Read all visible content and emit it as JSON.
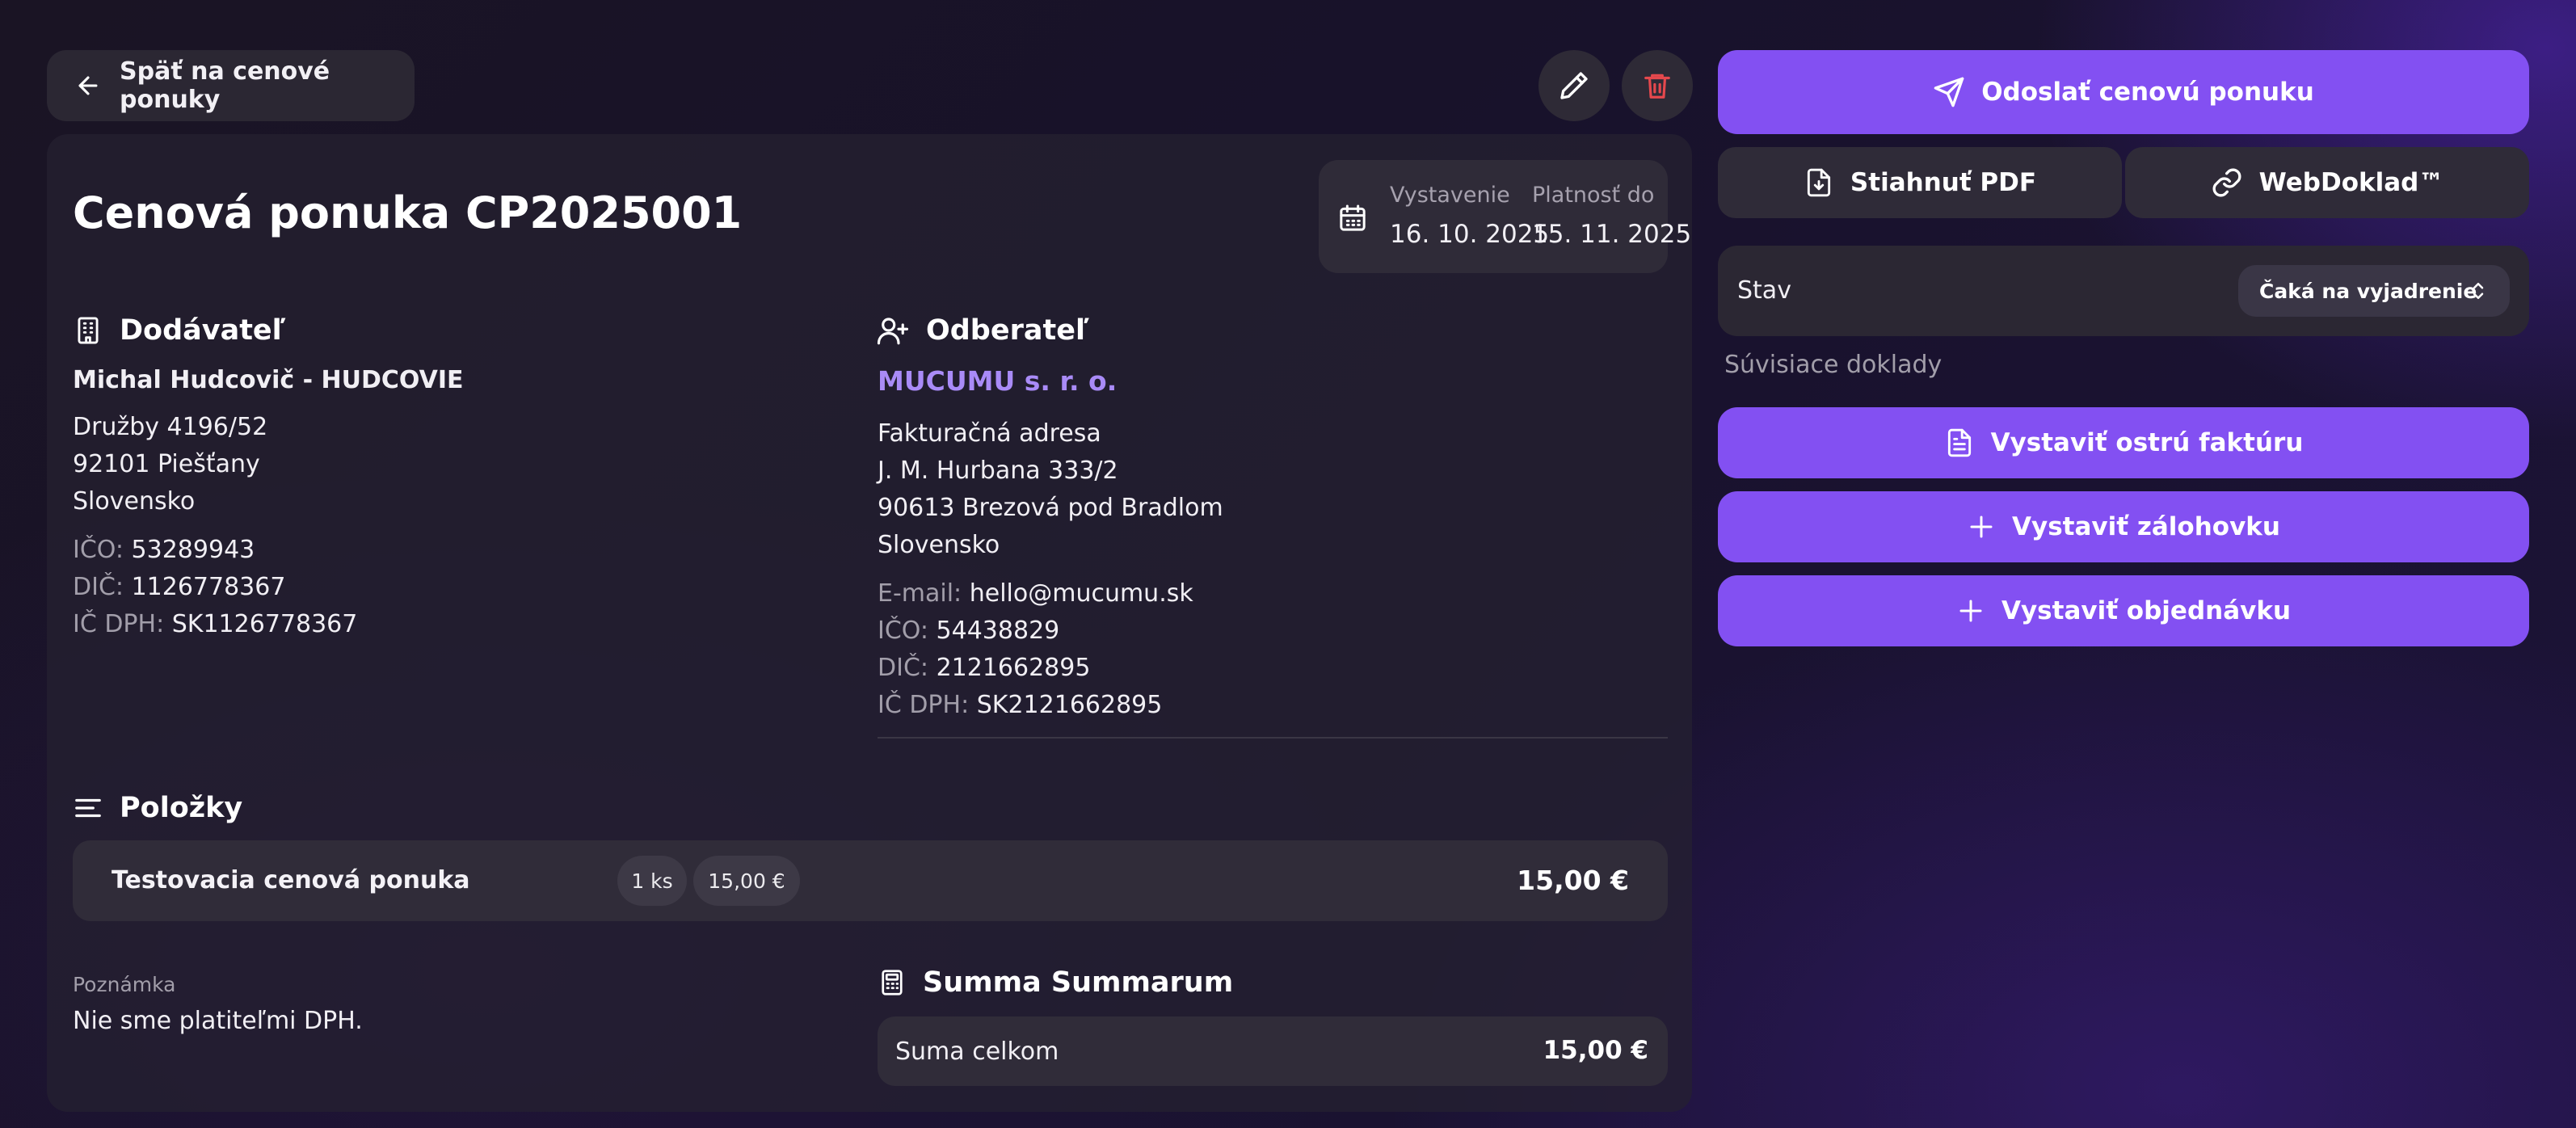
{
  "header": {
    "back_label": "Späť na cenové ponuky"
  },
  "document": {
    "title": "Cenová ponuka CP2025001",
    "issued_label": "Vystavenie",
    "issued_value": "16. 10. 2025",
    "valid_label": "Platnosť do",
    "valid_value": "15. 11. 2025"
  },
  "supplier": {
    "heading": "Dodávateľ",
    "name": "Michal Hudcovič - HUDCOVIE",
    "street": "Družby 4196/52",
    "city": "92101 Piešťany",
    "country": "Slovensko",
    "ico_label": "IČO:",
    "ico": "53289943",
    "dic_label": "DIČ:",
    "dic": "1126778367",
    "icdph_label": "IČ DPH:",
    "icdph": "SK1126778367"
  },
  "customer": {
    "heading": "Odberateľ",
    "name": "MUCUMU s. r. o.",
    "address_label": "Fakturačná adresa",
    "street": "J. M. Hurbana 333/2",
    "city": "90613 Brezová pod Bradlom",
    "country": "Slovensko",
    "email_label": "E-mail:",
    "email": "hello@mucumu.sk",
    "ico_label": "IČO:",
    "ico": "54438829",
    "dic_label": "DIČ:",
    "dic": "2121662895",
    "icdph_label": "IČ DPH:",
    "icdph": "SK2121662895"
  },
  "items": {
    "heading": "Položky",
    "rows": [
      {
        "name": "Testovacia cenová ponuka",
        "qty": "1 ks",
        "unit_price": "15,00 €",
        "total": "15,00 €"
      }
    ]
  },
  "note": {
    "label": "Poznámka",
    "text": "Nie sme platiteľmi DPH."
  },
  "summary": {
    "heading": "Summa Summarum",
    "total_label": "Suma celkom",
    "total_value": "15,00 €"
  },
  "actions": {
    "send_label": "Odoslať cenovú ponuku",
    "pdf_label": "Stiahnuť PDF",
    "webdoklad_label": "WebDoklad™",
    "status_label": "Stav",
    "status_value": "Čaká na vyjadrenie",
    "related_label": "Súvisiace doklady",
    "invoice_label": "Vystaviť ostrú faktúru",
    "advance_label": "Vystaviť zálohovku",
    "order_label": "Vystaviť objednávku"
  },
  "colors": {
    "accent": "#8350f2",
    "customer_name": "#a98bf7",
    "delete": "#e5484d"
  }
}
